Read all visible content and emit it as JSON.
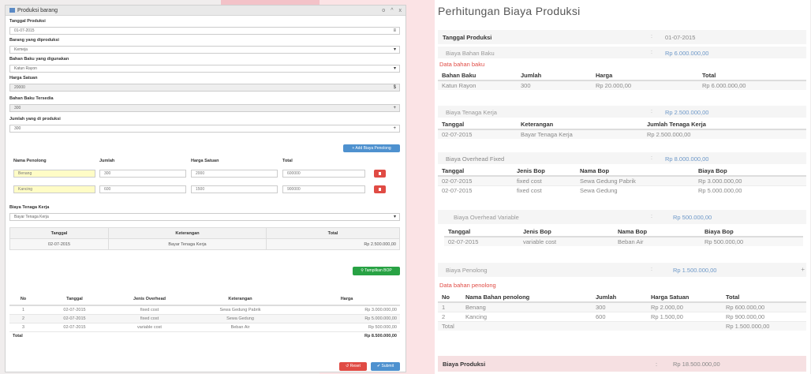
{
  "window": {
    "title": "Produksi barang",
    "ctl_min": "o",
    "ctl_max": "^",
    "ctl_close": "x"
  },
  "form": {
    "tanggal_label": "Tanggal Produksi",
    "tanggal_value": "01-07-2015",
    "barang_label": "Barang yang diproduksi",
    "barang_value": "Kemeja",
    "bahan_label": "Bahan Baku yang digunakan",
    "bahan_value": "Katun Rayon",
    "harga_label": "Harga Satuan",
    "harga_value": "20000",
    "currency": "$",
    "bahan_tersedia_label": "Bahan Baku Tersedia",
    "bahan_tersedia_value": "300",
    "jumlah_label": "Jumlah yang di produksi",
    "jumlah_value": "300",
    "add_penolong_btn": "+ Add Biaya Penolong"
  },
  "penolong": {
    "headers": [
      "Nama Penolong",
      "Jumlah",
      "Harga Satuan",
      "Total"
    ],
    "rows": [
      {
        "nama": "Benang",
        "jumlah": "300",
        "harga": "2000",
        "total": "600000"
      },
      {
        "nama": "Kancing",
        "jumlah": "600",
        "harga": "1500",
        "total": "900000"
      }
    ]
  },
  "tenaga": {
    "label": "Biaya Tenaga Kerja",
    "select_value": "Bayar Tenaga Kerja",
    "headers": [
      "Tanggal",
      "Keterangan",
      "Total"
    ],
    "row": [
      "02-07-2015",
      "Bayar Tenaga Kerja",
      "Rp 2.500.000,00"
    ]
  },
  "tampilkan_btn": "Tampilkan BOP",
  "bop": {
    "headers": [
      "No",
      "Tanggal",
      "Jenis Overhead",
      "Keterangan",
      "Harga"
    ],
    "rows": [
      [
        "1",
        "02-07-2015",
        "fixed cost",
        "Sewa Gedung Pabrik",
        "Rp 3.000.000,00"
      ],
      [
        "2",
        "02-07-2015",
        "fixed cost",
        "Sewa Gedung",
        "Rp 5.000.000,00"
      ],
      [
        "3",
        "02-07-2015",
        "variable cost",
        "Beban Air",
        "Rp 500.000,00"
      ]
    ],
    "total_label": "Total",
    "total_value": "Rp 8.500.000,00"
  },
  "buttons": {
    "reset": "Reset",
    "submit": "Submit"
  },
  "right": {
    "title": "Perhitungan Biaya Produksi",
    "tanggal_label": "Tanggal Produksi",
    "colon": ":",
    "tanggal_value": "01-07-2015",
    "bahan_baku_label": "Biaya Bahan Baku",
    "bahan_baku_value": "Rp 6.000.000,00",
    "data_bahan_baku": "Data bahan baku",
    "bb_headers": [
      "Bahan Baku",
      "Jumlah",
      "Harga",
      "Total"
    ],
    "bb_row": [
      "Katun Rayon",
      "300",
      "Rp 20.000,00",
      "Rp 6.000.000,00"
    ],
    "tk_label": "Biaya Tenaga Kerja",
    "tk_value": "Rp 2.500.000,00",
    "tk_headers": [
      "Tanggal",
      "Keterangan",
      "Jumlah Tenaga Kerja"
    ],
    "tk_row": [
      "02-07-2015",
      "Bayar Tenaga Kerja",
      "Rp 2.500.000,00"
    ],
    "bof_label": "Biaya Overhead Fixed",
    "bof_value": "Rp 8.000.000,00",
    "bof_headers": [
      "Tanggal",
      "Jenis Bop",
      "Nama Bop",
      "Biaya Bop"
    ],
    "bof_rows": [
      [
        "02-07-2015",
        "fixed cost",
        "Sewa Gedung Pabrik",
        "Rp 3.000.000,00"
      ],
      [
        "02-07-2015",
        "fixed cost",
        "Sewa Gedung",
        "Rp 5.000.000,00"
      ]
    ],
    "bov_label": "Biaya Overhead Variable",
    "bov_value": "Rp 500.000,00",
    "bov_headers": [
      "Tanggal",
      "Jenis Bop",
      "Nama Bop",
      "Biaya Bop"
    ],
    "bov_row": [
      "02-07-2015",
      "variable cost",
      "Beban Air",
      "Rp 500.000,00"
    ],
    "bp_label": "Biaya Penolong",
    "bp_value": "Rp 1.500.000,00",
    "plus": "+",
    "data_bahan_penolong": "Data bahan penolong",
    "bp_headers": [
      "No",
      "Nama Bahan penolong",
      "Jumlah",
      "Harga Satuan",
      "Total"
    ],
    "bp_rows": [
      [
        "1",
        "Benang",
        "300",
        "Rp 2.000,00",
        "Rp 600.000,00"
      ],
      [
        "2",
        "Kancing",
        "600",
        "Rp 1.500,00",
        "Rp 900.000,00"
      ]
    ],
    "bp_total_label": "Total",
    "bp_total_value": "Rp 1.500.000,00",
    "final_label": "Biaya Produksi",
    "final_value": "Rp 18.500.000,00"
  }
}
